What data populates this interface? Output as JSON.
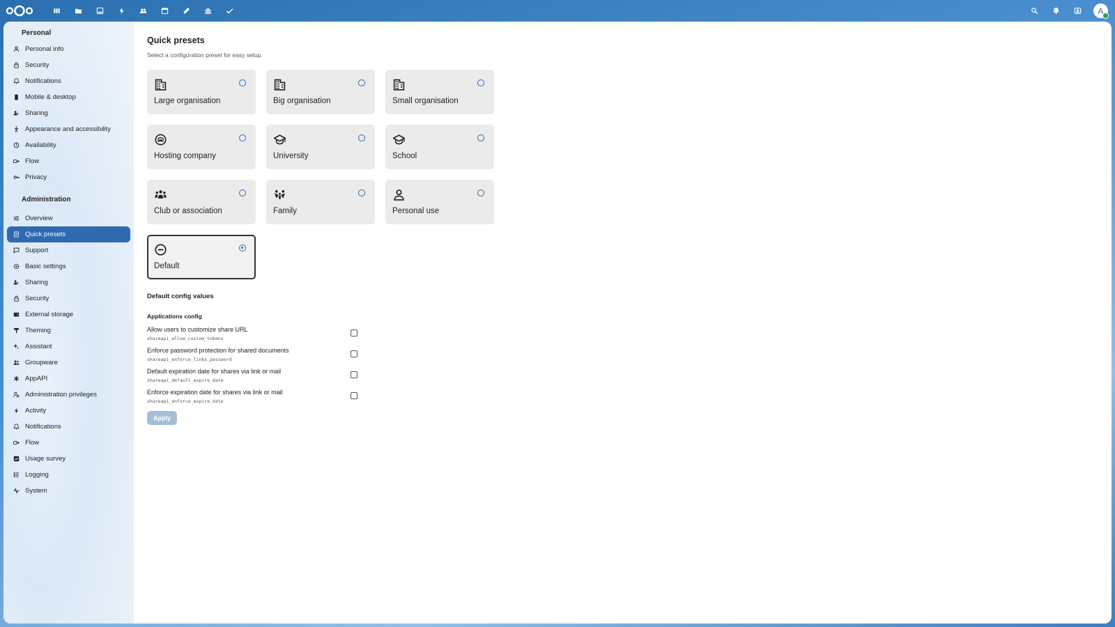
{
  "topbar": {
    "app_icons": [
      "dashboard-icon",
      "files-icon",
      "photos-icon",
      "activity-icon",
      "contacts-icon",
      "calendar-icon",
      "notes-icon",
      "deck-icon",
      "tasks-icon"
    ],
    "right_icons": [
      "search-icon",
      "notifications-icon",
      "contacts-menu-icon"
    ],
    "avatar_letter": "A"
  },
  "sidebar": {
    "personal_heading": "Personal",
    "personal_items": [
      {
        "label": "Personal info",
        "icon": "user-icon"
      },
      {
        "label": "Security",
        "icon": "lock-icon"
      },
      {
        "label": "Notifications",
        "icon": "bell-icon"
      },
      {
        "label": "Mobile & desktop",
        "icon": "phone-icon"
      },
      {
        "label": "Sharing",
        "icon": "share-icon"
      },
      {
        "label": "Appearance and accessibility",
        "icon": "accessibility-icon"
      },
      {
        "label": "Availability",
        "icon": "clock-icon"
      },
      {
        "label": "Flow",
        "icon": "flow-icon"
      },
      {
        "label": "Privacy",
        "icon": "key-icon"
      }
    ],
    "admin_heading": "Administration",
    "admin_items": [
      {
        "label": "Overview",
        "icon": "tune-icon"
      },
      {
        "label": "Quick presets",
        "icon": "presets-icon"
      },
      {
        "label": "Support",
        "icon": "support-icon"
      },
      {
        "label": "Basic settings",
        "icon": "settings-icon"
      },
      {
        "label": "Sharing",
        "icon": "share-icon"
      },
      {
        "label": "Security",
        "icon": "lock-icon"
      },
      {
        "label": "External storage",
        "icon": "storage-icon"
      },
      {
        "label": "Theming",
        "icon": "paint-icon"
      },
      {
        "label": "Assistant",
        "icon": "sparkle-icon"
      },
      {
        "label": "Groupware",
        "icon": "group-icon"
      },
      {
        "label": "AppAPI",
        "icon": "api-icon"
      },
      {
        "label": "Administration privileges",
        "icon": "admin-icon"
      },
      {
        "label": "Activity",
        "icon": "bolt-icon"
      },
      {
        "label": "Notifications",
        "icon": "bell-icon"
      },
      {
        "label": "Flow",
        "icon": "flow-icon"
      },
      {
        "label": "Usage survey",
        "icon": "chart-icon"
      },
      {
        "label": "Logging",
        "icon": "list-icon"
      },
      {
        "label": "System",
        "icon": "pulse-icon"
      }
    ],
    "active_admin_index": 1
  },
  "main": {
    "title": "Quick presets",
    "description": "Select a configuration preset for easy setup.",
    "presets": [
      {
        "label": "Large organisation",
        "icon": "building-icon",
        "selected": false
      },
      {
        "label": "Big organisation",
        "icon": "building-icon",
        "selected": false
      },
      {
        "label": "Small organisation",
        "icon": "building-icon",
        "selected": false
      },
      {
        "label": "Hosting company",
        "icon": "hosting-icon",
        "selected": false
      },
      {
        "label": "University",
        "icon": "graduation-cap-icon",
        "selected": false
      },
      {
        "label": "School",
        "icon": "graduation-cap-icon",
        "selected": false
      },
      {
        "label": "Club or association",
        "icon": "people-group-icon",
        "selected": false
      },
      {
        "label": "Family",
        "icon": "family-icon",
        "selected": false
      },
      {
        "label": "Personal use",
        "icon": "person-icon",
        "selected": false
      },
      {
        "label": "Default",
        "icon": "minus-circle-icon",
        "selected": true
      }
    ],
    "config_title": "Default config values",
    "applications_title": "Applications config",
    "config_rows": [
      {
        "label": "Allow users to customize share URL",
        "key": "shareapi_allow_custom_tokens",
        "checked": false
      },
      {
        "label": "Enforce password protection for shared documents",
        "key": "shareapi_enforce_links_password",
        "checked": false
      },
      {
        "label": "Default expiration date for shares via link or mail",
        "key": "shareapi_default_expire_date",
        "checked": false
      },
      {
        "label": "Enforce expiration date for shares via link or mail",
        "key": "shareapi_enforce_expire_date",
        "checked": false
      }
    ],
    "apply_label": "Apply"
  },
  "colors": {
    "header": "#2a6fb0",
    "accent": "#2e6ab0",
    "card": "#ebebeb",
    "apply_disabled": "#a5bfd8"
  }
}
